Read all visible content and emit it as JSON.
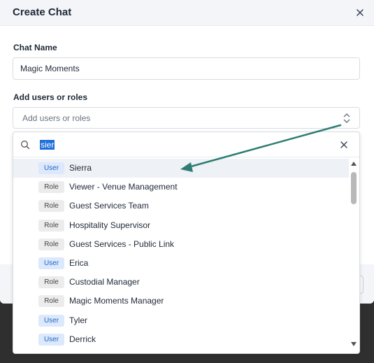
{
  "modal": {
    "title": "Create Chat",
    "chat_name_label": "Chat Name",
    "chat_name_value": "Magic Moments",
    "add_users_label": "Add users or roles",
    "add_users_placeholder": "Add users or roles"
  },
  "dropdown": {
    "search_value": "sier",
    "items": [
      {
        "type": "User",
        "name": "Sierra"
      },
      {
        "type": "Role",
        "name": "Viewer - Venue Management"
      },
      {
        "type": "Role",
        "name": "Guest Services Team"
      },
      {
        "type": "Role",
        "name": "Hospitality Supervisor"
      },
      {
        "type": "Role",
        "name": "Guest Services - Public Link"
      },
      {
        "type": "User",
        "name": "Erica"
      },
      {
        "type": "Role",
        "name": "Custodial Manager"
      },
      {
        "type": "Role",
        "name": "Magic Moments Manager"
      },
      {
        "type": "User",
        "name": "Tyler"
      },
      {
        "type": "User",
        "name": "Derrick"
      }
    ]
  },
  "icons": {
    "close": "close-icon",
    "select_caret": "up-down-chevron-icon",
    "search": "search-icon",
    "clear": "clear-icon",
    "scroll_up": "scroll-up-icon",
    "scroll_down": "scroll-down-icon",
    "annotation": "annotation-arrow"
  },
  "colors": {
    "header_bg": "#f3f5f8",
    "user_badge_bg": "#dce8fb",
    "user_badge_text": "#1f66c8",
    "role_badge_bg": "#ececec",
    "search_highlight": "#1e6fd9",
    "annotation_arrow": "#2e7d73"
  }
}
